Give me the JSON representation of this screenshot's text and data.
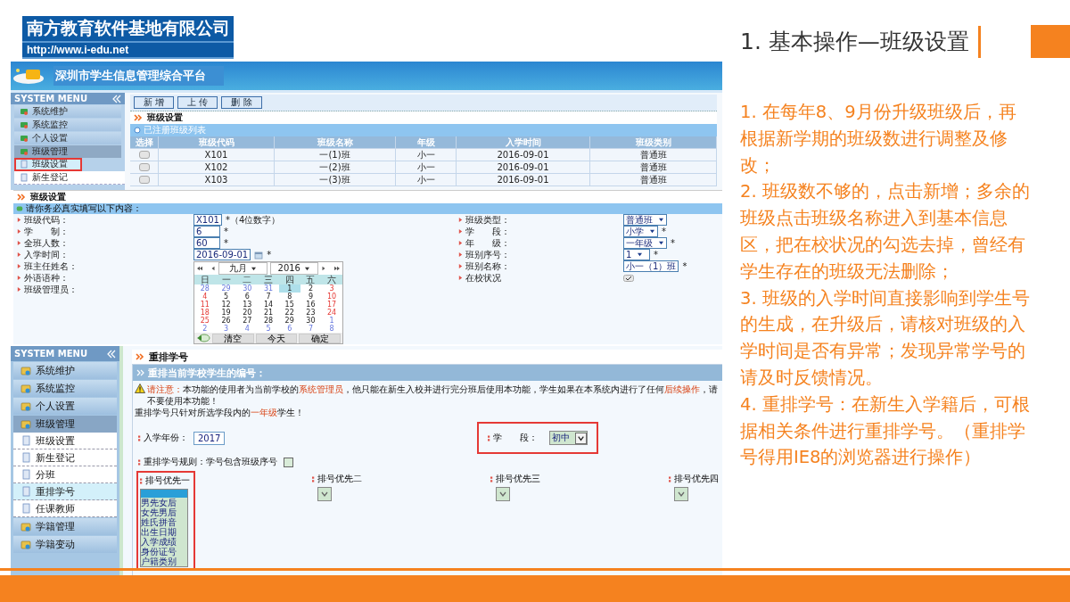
{
  "logo": {
    "company": "南方教育软件基地有限公司",
    "url": "http://www.i-edu.net"
  },
  "slide": {
    "title": "1. 基本操作—班级设置",
    "notes": [
      "1. 在每年8、9月份升级班级后，再根据新学期的班级数进行调整及修改；",
      "2. 班级数不够的，点击新增；多余的班级点击班级名称进入到基本信息区，把在校状况的勾选去掉，曾经有学生存在的班级无法删除；",
      "3. 班级的入学时间直接影响到学生号的生成，在升级后，请核对班级的入学时间是否有异常；发现异常学号的请及时反馈情况。",
      "4. 重排学号：在新生入学籍后，可根据相关条件进行重排学号。（重排学号得用IE8的浏览器进行操作）"
    ]
  },
  "class_list_screen": {
    "banner_title": "深圳市学生信息管理综合平台",
    "menu_title": "SYSTEM MENU",
    "menu": [
      {
        "label": "系统维护",
        "kind": "group",
        "selected": false,
        "highlighted": false
      },
      {
        "label": "系统监控",
        "kind": "group",
        "selected": false,
        "highlighted": false
      },
      {
        "label": "个人设置",
        "kind": "group",
        "selected": false,
        "highlighted": false
      },
      {
        "label": "班级管理",
        "kind": "group",
        "selected": true,
        "highlighted": false
      },
      {
        "label": "班级设置",
        "kind": "item",
        "selected": true,
        "highlighted": true
      },
      {
        "label": "新生登记",
        "kind": "item",
        "selected": false,
        "highlighted": false
      }
    ],
    "toolbar": [
      "新 增",
      "上 传",
      "删 除"
    ],
    "section_title": "班级设置",
    "list_title": "已注册班级列表",
    "table": {
      "select_column": "选择",
      "columns": [
        "班级代码",
        "班级名称",
        "年级",
        "入学时间",
        "班级类别"
      ],
      "rows": [
        {
          "checked": false,
          "cells": [
            "X101",
            "一(1)班",
            "小一",
            "2016-09-01",
            "普通班"
          ]
        },
        {
          "checked": false,
          "cells": [
            "X102",
            "一(2)班",
            "小一",
            "2016-09-01",
            "普通班"
          ]
        },
        {
          "checked": false,
          "cells": [
            "X103",
            "一(3)班",
            "小一",
            "2016-09-01",
            "普通班"
          ]
        }
      ]
    }
  },
  "class_form": {
    "section_title": "班级设置",
    "notice": "请你务必真实填写以下内容：",
    "left_fields": [
      {
        "label": "班级代码：",
        "kind": "text",
        "value": "X101",
        "hint": "*（4位数字）"
      },
      {
        "label": "学　　制：",
        "kind": "text",
        "value": "6",
        "hint": "*"
      },
      {
        "label": "全班人数：",
        "kind": "text",
        "value": "60",
        "hint": "*"
      },
      {
        "label": "入学时间：",
        "kind": "date",
        "value": "2016-09-01",
        "hint": "*"
      },
      {
        "label": "班主任姓名：",
        "kind": "none"
      },
      {
        "label": "外语语种：",
        "kind": "none"
      },
      {
        "label": "班级管理员：",
        "kind": "none"
      }
    ],
    "right_fields": [
      {
        "label": "班级类型：",
        "kind": "select",
        "value": "普通班"
      },
      {
        "label": "学　　段：",
        "kind": "select",
        "value": "小学",
        "hint": "*"
      },
      {
        "label": "年　　级：",
        "kind": "select",
        "value": "一年级",
        "hint": "*"
      },
      {
        "label": "班别序号：",
        "kind": "select",
        "value": "1",
        "hint": "*"
      },
      {
        "label": "班别名称：",
        "kind": "text",
        "value": "小一（1）班",
        "hint": "*"
      },
      {
        "label": "在校状况",
        "kind": "checkbox",
        "checked": true
      }
    ],
    "calendar": {
      "month": "九月",
      "year": "2016",
      "weekdays": [
        "日",
        "一",
        "二",
        "三",
        "四",
        "五",
        "六"
      ],
      "weeks": [
        [
          {
            "day": "28",
            "other_month": true,
            "selected": false
          },
          {
            "day": "29",
            "other_month": true,
            "selected": false
          },
          {
            "day": "30",
            "other_month": true,
            "selected": false
          },
          {
            "day": "31",
            "other_month": true,
            "selected": false
          },
          {
            "day": "1",
            "other_month": false,
            "selected": true
          },
          {
            "day": "2",
            "other_month": false,
            "selected": false
          },
          {
            "day": "3",
            "other_month": false,
            "selected": false
          }
        ],
        [
          {
            "day": "4",
            "other_month": false,
            "selected": false
          },
          {
            "day": "5",
            "other_month": false,
            "selected": false
          },
          {
            "day": "6",
            "other_month": false,
            "selected": false
          },
          {
            "day": "7",
            "other_month": false,
            "selected": false
          },
          {
            "day": "8",
            "other_month": false,
            "selected": false
          },
          {
            "day": "9",
            "other_month": false,
            "selected": false
          },
          {
            "day": "10",
            "other_month": false,
            "selected": false
          }
        ],
        [
          {
            "day": "11",
            "other_month": false,
            "selected": false
          },
          {
            "day": "12",
            "other_month": false,
            "selected": false
          },
          {
            "day": "13",
            "other_month": false,
            "selected": false
          },
          {
            "day": "14",
            "other_month": false,
            "selected": false
          },
          {
            "day": "15",
            "other_month": false,
            "selected": false
          },
          {
            "day": "16",
            "other_month": false,
            "selected": false
          },
          {
            "day": "17",
            "other_month": false,
            "selected": false
          }
        ],
        [
          {
            "day": "18",
            "other_month": false,
            "selected": false
          },
          {
            "day": "19",
            "other_month": false,
            "selected": false
          },
          {
            "day": "20",
            "other_month": false,
            "selected": false
          },
          {
            "day": "21",
            "other_month": false,
            "selected": false
          },
          {
            "day": "22",
            "other_month": false,
            "selected": false
          },
          {
            "day": "23",
            "other_month": false,
            "selected": false
          },
          {
            "day": "24",
            "other_month": false,
            "selected": false
          }
        ],
        [
          {
            "day": "25",
            "other_month": false,
            "selected": false
          },
          {
            "day": "26",
            "other_month": false,
            "selected": false
          },
          {
            "day": "27",
            "other_month": false,
            "selected": false
          },
          {
            "day": "28",
            "other_month": false,
            "selected": false
          },
          {
            "day": "29",
            "other_month": false,
            "selected": false
          },
          {
            "day": "30",
            "other_month": false,
            "selected": false
          },
          {
            "day": "1",
            "other_month": true,
            "selected": false
          }
        ],
        [
          {
            "day": "2",
            "other_month": true,
            "selected": false
          },
          {
            "day": "3",
            "other_month": true,
            "selected": false
          },
          {
            "day": "4",
            "other_month": true,
            "selected": false
          },
          {
            "day": "5",
            "other_month": true,
            "selected": false
          },
          {
            "day": "6",
            "other_month": true,
            "selected": false
          },
          {
            "day": "7",
            "other_month": true,
            "selected": false
          },
          {
            "day": "8",
            "other_month": true,
            "selected": false
          }
        ]
      ],
      "buttons": [
        "清空",
        "今天",
        "确定"
      ]
    }
  },
  "renumber_screen": {
    "menu_title": "SYSTEM MENU",
    "menu": [
      {
        "label": "系统维护",
        "kind": "group",
        "selected": false
      },
      {
        "label": "系统监控",
        "kind": "group",
        "selected": false
      },
      {
        "label": "个人设置",
        "kind": "group",
        "selected": false
      },
      {
        "label": "班级管理",
        "kind": "group",
        "selected": true
      },
      {
        "label": "班级设置",
        "kind": "item",
        "selected": false
      },
      {
        "label": "新生登记",
        "kind": "item",
        "selected": false
      },
      {
        "label": "分班",
        "kind": "item",
        "selected": false
      },
      {
        "label": "重排学号",
        "kind": "item",
        "selected": true
      },
      {
        "label": "任课教师",
        "kind": "item",
        "selected": false
      },
      {
        "label": "学籍管理",
        "kind": "group",
        "selected": false
      },
      {
        "label": "学籍变动",
        "kind": "group",
        "selected": false
      }
    ],
    "section_title": "重排学号",
    "subtitle": "重排当前学校学生的编号：",
    "warning": [
      {
        "text": "请注意：",
        "emphasis": true
      },
      {
        "text": "本功能的使用者为当前学校的",
        "emphasis": false
      },
      {
        "text": "系统管理员",
        "emphasis": true
      },
      {
        "text": "，他只能在新生入校并进行完分班后使用本功能，学生如果在本系统内进行了任何",
        "emphasis": false
      },
      {
        "text": "后续操作",
        "emphasis": true
      },
      {
        "text": "，请不要使用本功能！",
        "emphasis": false
      }
    ],
    "scope_note": [
      {
        "text": "重排学号只针对所选学段内的",
        "emphasis": false
      },
      {
        "text": "一年级",
        "emphasis": true
      },
      {
        "text": "学生！",
        "emphasis": false
      }
    ],
    "year_field": {
      "label": "入学年份：",
      "value": "2017"
    },
    "stage_field": {
      "label": "学　　段：",
      "value": "初中",
      "highlighted": true
    },
    "rule_field": {
      "label": "重排学号规则：学号包含班级序号",
      "checked": false
    },
    "priorities": [
      {
        "label": "排号优先一",
        "expanded": true,
        "highlighted": true,
        "options": [
          "男先女后",
          "女先男后",
          "姓氏拼音",
          "出生日期",
          "入学成绩",
          "身份证号",
          "户籍类别"
        ]
      },
      {
        "label": "排号优先二",
        "expanded": false,
        "highlighted": false
      },
      {
        "label": "排号优先三",
        "expanded": false,
        "highlighted": false
      },
      {
        "label": "排号优先四",
        "expanded": false,
        "highlighted": false
      }
    ]
  }
}
